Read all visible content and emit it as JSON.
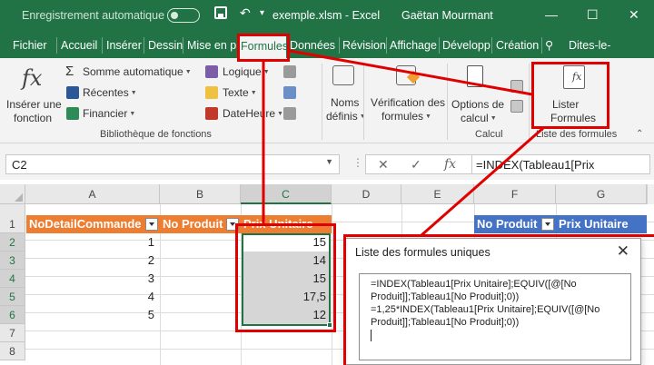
{
  "titlebar": {
    "autosave_label": "Enregistrement automatique",
    "filename": "exemple.xlsm",
    "separator": "-",
    "app": "Excel",
    "user": "Gaëtan Mourmant",
    "minimize": "—",
    "restore": "☐",
    "close": "✕"
  },
  "tabs": {
    "fichier": "Fichier",
    "accueil": "Accueil",
    "inserer": "Insérer",
    "dessin": "Dessin",
    "mise_en_page": "Mise en p",
    "formules": "Formules",
    "donnees": "Données",
    "revision": "Révision",
    "affichage": "Affichage",
    "developpeur": "Développ",
    "creation": "Création",
    "dites_le": "Dites-le-"
  },
  "ribbon": {
    "inserer_fonction_line1": "Insérer une",
    "inserer_fonction_line2": "fonction",
    "somme_auto": "Somme automatique",
    "recentes": "Récentes",
    "financier": "Financier",
    "logique": "Logique",
    "texte": "Texte",
    "date_heure": "DateHeure",
    "noms_line1": "Noms",
    "noms_line2": "définis",
    "verif_line1": "Vérification des",
    "verif_line2": "formules",
    "options_line1": "Options de",
    "options_line2": "calcul",
    "lister_line1": "Lister",
    "lister_line2": "Formules",
    "group_biblio": "Bibliothèque de fonctions",
    "group_calcul": "Calcul",
    "group_liste": "Liste des formules"
  },
  "formula_bar": {
    "name_box": "C2",
    "formula": "=INDEX(Tableau1[Prix"
  },
  "grid": {
    "columns": [
      "A",
      "B",
      "C",
      "D",
      "E",
      "F",
      "G"
    ],
    "rows": [
      "1",
      "2",
      "3",
      "4",
      "5",
      "6",
      "7",
      "8"
    ],
    "header_a": "NoDetailCommande",
    "header_b": "No Produit",
    "header_c": "Prix Unitaire",
    "header_f": "No Produit",
    "header_g": "Prix Unitaire",
    "col_a": [
      "1",
      "2",
      "3",
      "4",
      "5"
    ],
    "col_c": [
      "15",
      "14",
      "15",
      "17,5",
      "12"
    ]
  },
  "popup": {
    "title": "Liste des formules uniques",
    "close": "✕",
    "formula1": "=INDEX(Tableau1[Prix Unitaire];EQUIV([@[No Produit]];Tableau1[No Produit];0))",
    "formula2": "=1,25*INDEX(Tableau1[Prix Unitaire];EQUIV([@[No Produit]];Tableau1[No Produit];0))"
  },
  "colors": {
    "excel_green": "#217346",
    "table_orange": "#ed7d31",
    "table_blue": "#4472c4",
    "annotation_red": "#e00000"
  }
}
